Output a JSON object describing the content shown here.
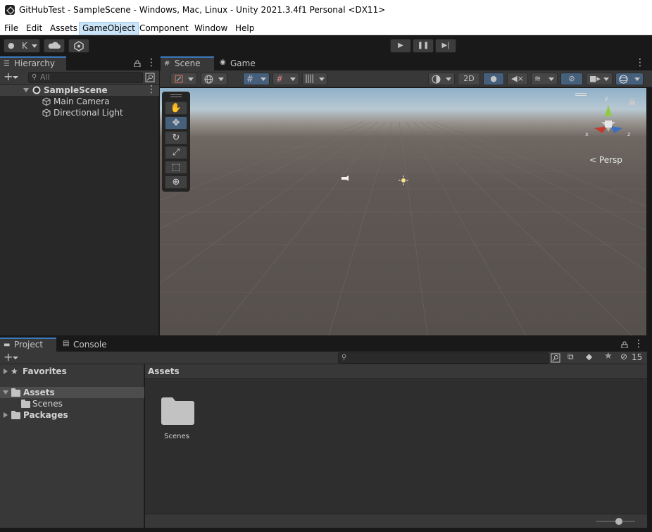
{
  "window": {
    "title": "GitHubTest - SampleScene - Windows, Mac, Linux - Unity 2021.3.4f1 Personal <DX11>"
  },
  "menu": [
    "File",
    "Edit",
    "Assets",
    "GameObject",
    "Component",
    "Window",
    "Help"
  ],
  "toolbar": {
    "account_label": "K"
  },
  "hierarchy": {
    "tab": "Hierarchy",
    "search_placeholder": "All",
    "scene": "SampleScene",
    "items": [
      "Main Camera",
      "Directional Light"
    ]
  },
  "scene_view": {
    "tabs": [
      "Scene",
      "Game"
    ],
    "toggle_2d": "2D",
    "gizmo_axes": {
      "x": "x",
      "y": "y",
      "z": "z"
    },
    "projection": "Persp"
  },
  "bottom": {
    "tabs": [
      "Project",
      "Console"
    ],
    "hidden_count": "15",
    "tree": {
      "favorites": "Favorites",
      "assets": "Assets",
      "scenes": "Scenes",
      "packages": "Packages"
    },
    "breadcrumb": "Assets",
    "grid_items": [
      {
        "label": "Scenes",
        "icon": "folder-icon"
      }
    ]
  }
}
